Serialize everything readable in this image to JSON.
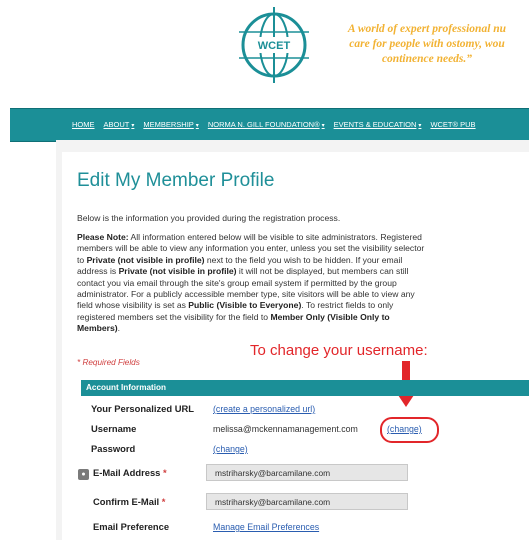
{
  "header": {
    "logo_text": "WCET",
    "tagline_lines": [
      "A world of expert professional nu",
      "care for people with ostomy, wou",
      "continence needs.”"
    ]
  },
  "nav": {
    "items": [
      {
        "label": "HOME",
        "caret": ""
      },
      {
        "label": "ABOUT",
        "caret": "▾"
      },
      {
        "label": "MEMBERSHIP",
        "caret": "▾"
      },
      {
        "label": "NORMA N. GILL FOUNDATION®",
        "caret": "▾"
      },
      {
        "label": "EVENTS & EDUCATION",
        "caret": "▾"
      },
      {
        "label": "WCET® PUB",
        "caret": ""
      }
    ]
  },
  "page": {
    "title": "Edit My Member Profile",
    "intro": "Below is the information you provided during the registration process.",
    "note_lines": [
      [
        {
          "t": "Please Note:",
          "b": true
        },
        {
          "t": " All information entered below will be visible to site administrators. Registered",
          "b": false
        }
      ],
      [
        {
          "t": "members will be able to view any information you enter, unless you set the visibility selector",
          "b": false
        }
      ],
      [
        {
          "t": "to ",
          "b": false
        },
        {
          "t": "Private (not visible in profile)",
          "b": true
        },
        {
          "t": " next to the field you wish to be hidden. If your email",
          "b": false
        }
      ],
      [
        {
          "t": "address is ",
          "b": false
        },
        {
          "t": "Private (not visible in profile)",
          "b": true
        },
        {
          "t": " it will not be displayed, but members can still",
          "b": false
        }
      ],
      [
        {
          "t": "contact you via email through the site's group email system if permitted by the group",
          "b": false
        }
      ],
      [
        {
          "t": "administrator. For a publicly accessible member type, site visitors will be able to view any",
          "b": false
        }
      ],
      [
        {
          "t": "field whose visibility is set as ",
          "b": false
        },
        {
          "t": "Public (Visible to Everyone)",
          "b": true
        },
        {
          "t": ". To restrict fields to only",
          "b": false
        }
      ],
      [
        {
          "t": "registered members set the visibility for the field to ",
          "b": false
        },
        {
          "t": "Member Only (Visible Only to",
          "b": true
        }
      ],
      [
        {
          "t": "Members)",
          "b": true
        },
        {
          "t": ".",
          "b": false
        }
      ]
    ],
    "required_fields": "* Required Fields",
    "annotation": "To change your username:",
    "section_header": "Account Information",
    "rows": {
      "personal_url_label": "Your Personalized URL",
      "personal_url_link": "(create a personalized url)",
      "username_label": "Username",
      "username_value": "melissa@mckennamanagement.com",
      "username_change": "(change)",
      "password_label": "Password",
      "password_change": "(change)",
      "email_label": "E-Mail Address",
      "email_value": "mstriharsky@barcamilane.com",
      "confirm_label": "Confirm E-Mail",
      "confirm_value": "mstriharsky@barcamilane.com",
      "pref_label": "Email Preference",
      "pref_link": "Manage Email Preferences",
      "required_star": "*"
    }
  },
  "colors": {
    "teal": "#1b8f97",
    "gold": "#f2b233",
    "annotation_red": "#e2262a",
    "link_blue": "#2a5db0"
  }
}
